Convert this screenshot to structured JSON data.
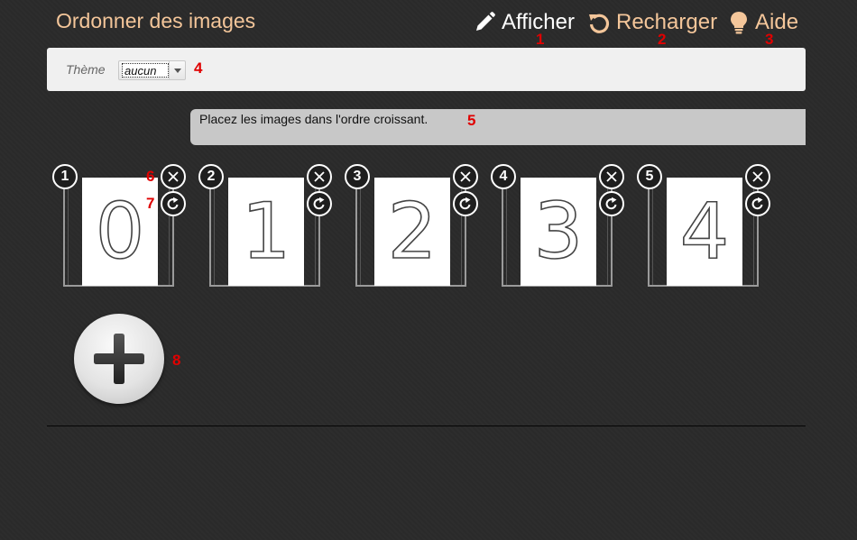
{
  "header": {
    "title": "Ordonner des images",
    "nav": [
      {
        "label": "Afficher",
        "icon": "pencil-icon",
        "marker": "1"
      },
      {
        "label": "Recharger",
        "icon": "reload-icon",
        "marker": "2"
      },
      {
        "label": "Aide",
        "icon": "lightbulb-icon",
        "marker": "3"
      }
    ]
  },
  "toolbar": {
    "theme_label": "Thème",
    "theme_value": "aucun",
    "marker": "4"
  },
  "instruction": {
    "text": "Placez les images dans l'ordre croissant.",
    "marker": "5"
  },
  "cards": [
    {
      "number": "1",
      "digit": "0"
    },
    {
      "number": "2",
      "digit": "1"
    },
    {
      "number": "3",
      "digit": "2"
    },
    {
      "number": "4",
      "digit": "3"
    },
    {
      "number": "5",
      "digit": "4"
    }
  ],
  "card_markers": {
    "delete": "6",
    "rotate": "7"
  },
  "add_button": {
    "icon": "plus-icon",
    "marker": "8"
  },
  "colors": {
    "accent": "#f4c69a",
    "background": "#2b2b2b",
    "toolbar": "#f0f0f0",
    "instruction_bg": "#c8c8c8",
    "marker": "#e00000"
  }
}
